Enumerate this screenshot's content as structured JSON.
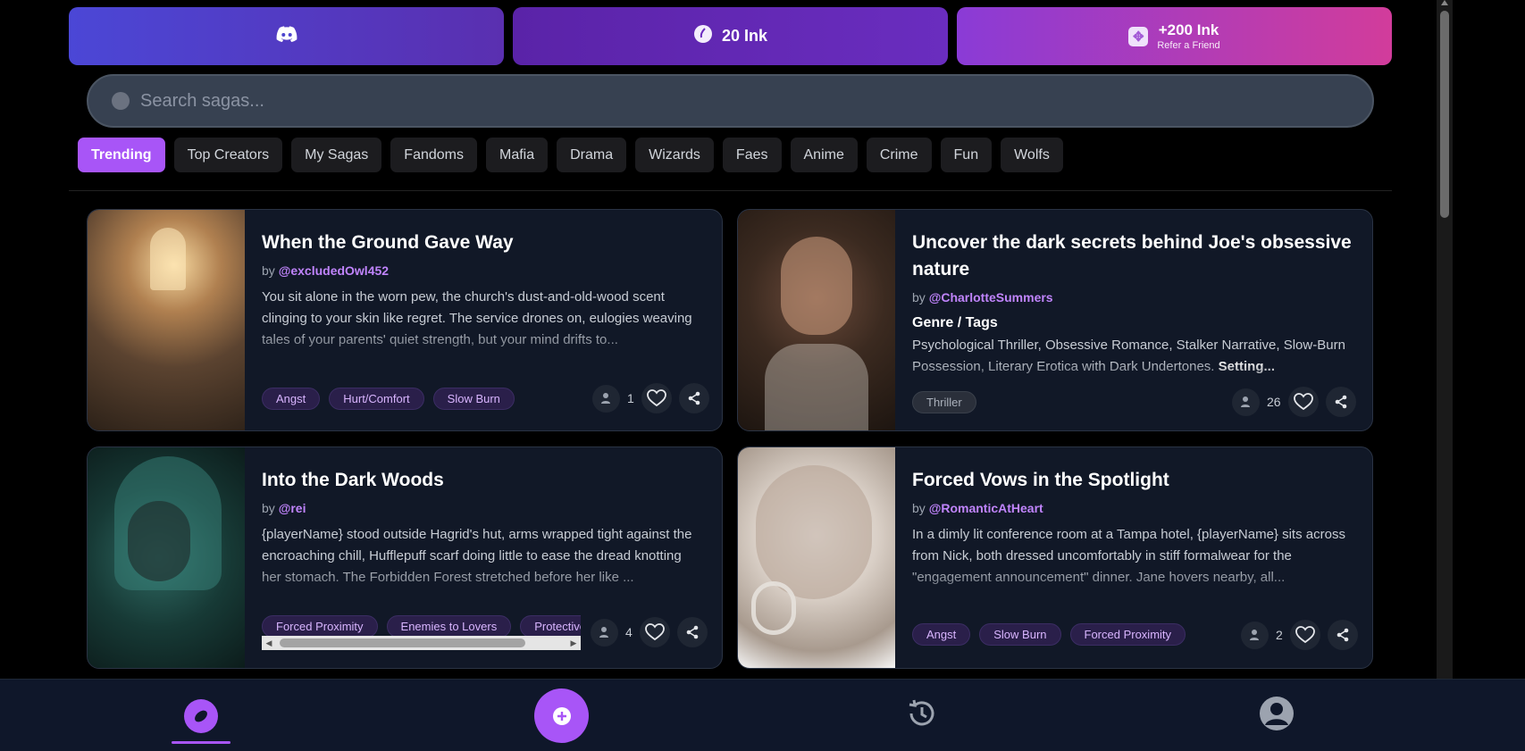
{
  "banner": {
    "ink_label": "20 Ink",
    "refer_main": "+200 Ink",
    "refer_sub": "Refer a Friend"
  },
  "search": {
    "placeholder": "Search sagas..."
  },
  "tabs": [
    {
      "label": "Trending"
    },
    {
      "label": "Top Creators"
    },
    {
      "label": "My Sagas"
    },
    {
      "label": "Fandoms"
    },
    {
      "label": "Mafia"
    },
    {
      "label": "Drama"
    },
    {
      "label": "Wizards"
    },
    {
      "label": "Faes"
    },
    {
      "label": "Anime"
    },
    {
      "label": "Crime"
    },
    {
      "label": "Fun"
    },
    {
      "label": "Wolfs"
    }
  ],
  "active_tab": "Trending",
  "cards": [
    {
      "title": "When the Ground Gave Way",
      "by": "by",
      "author": "@excludedOwl452",
      "description": "You sit alone in the worn pew, the church's dust-and-old-wood scent clinging to your skin like regret. The service drones on, eulogies weaving tales of your parents' quiet strength, but your mind drifts to...",
      "tags": [
        "Angst",
        "Hurt/Comfort",
        "Slow Burn"
      ],
      "count": "1"
    },
    {
      "title": "Uncover the dark secrets behind Joe's obsessive nature",
      "by": "by",
      "author": "@CharlotteSummers",
      "genre_heading": "Genre / Tags",
      "description": "Psychological Thriller, Obsessive Romance, Stalker Narrative, Slow-Burn Possession, Literary Erotica with Dark Undertones.",
      "description_bold": "Setting...",
      "tags": [
        "Thriller"
      ],
      "count": "26"
    },
    {
      "title": "Into the Dark Woods",
      "by": "by",
      "author": "@rei",
      "description": "{playerName} stood outside Hagrid's hut, arms wrapped tight against the encroaching chill, Hufflepuff scarf doing little to ease the dread knotting her stomach. The Forbidden Forest stretched before her like ...",
      "tags": [
        "Forced Proximity",
        "Enemies to Lovers",
        "Protective"
      ],
      "count": "4"
    },
    {
      "title": "Forced Vows in the Spotlight",
      "by": "by",
      "author": "@RomanticAtHeart",
      "description": "In a dimly lit conference room at a Tampa hotel, {playerName} sits across from Nick, both dressed uncomfortably in stiff formalwear for the \"engagement announcement\" dinner. Jane hovers nearby, all...",
      "tags": [
        "Angst",
        "Slow Burn",
        "Forced Proximity"
      ],
      "count": "2"
    }
  ],
  "colors": {
    "accent": "#a855f7",
    "card_bg": "#111827",
    "tag_bg": "#2a1f4a",
    "nav_bg": "#0f172a"
  },
  "nav": [
    "explore-icon",
    "create-plus-icon",
    "history-icon",
    "profile-icon"
  ]
}
